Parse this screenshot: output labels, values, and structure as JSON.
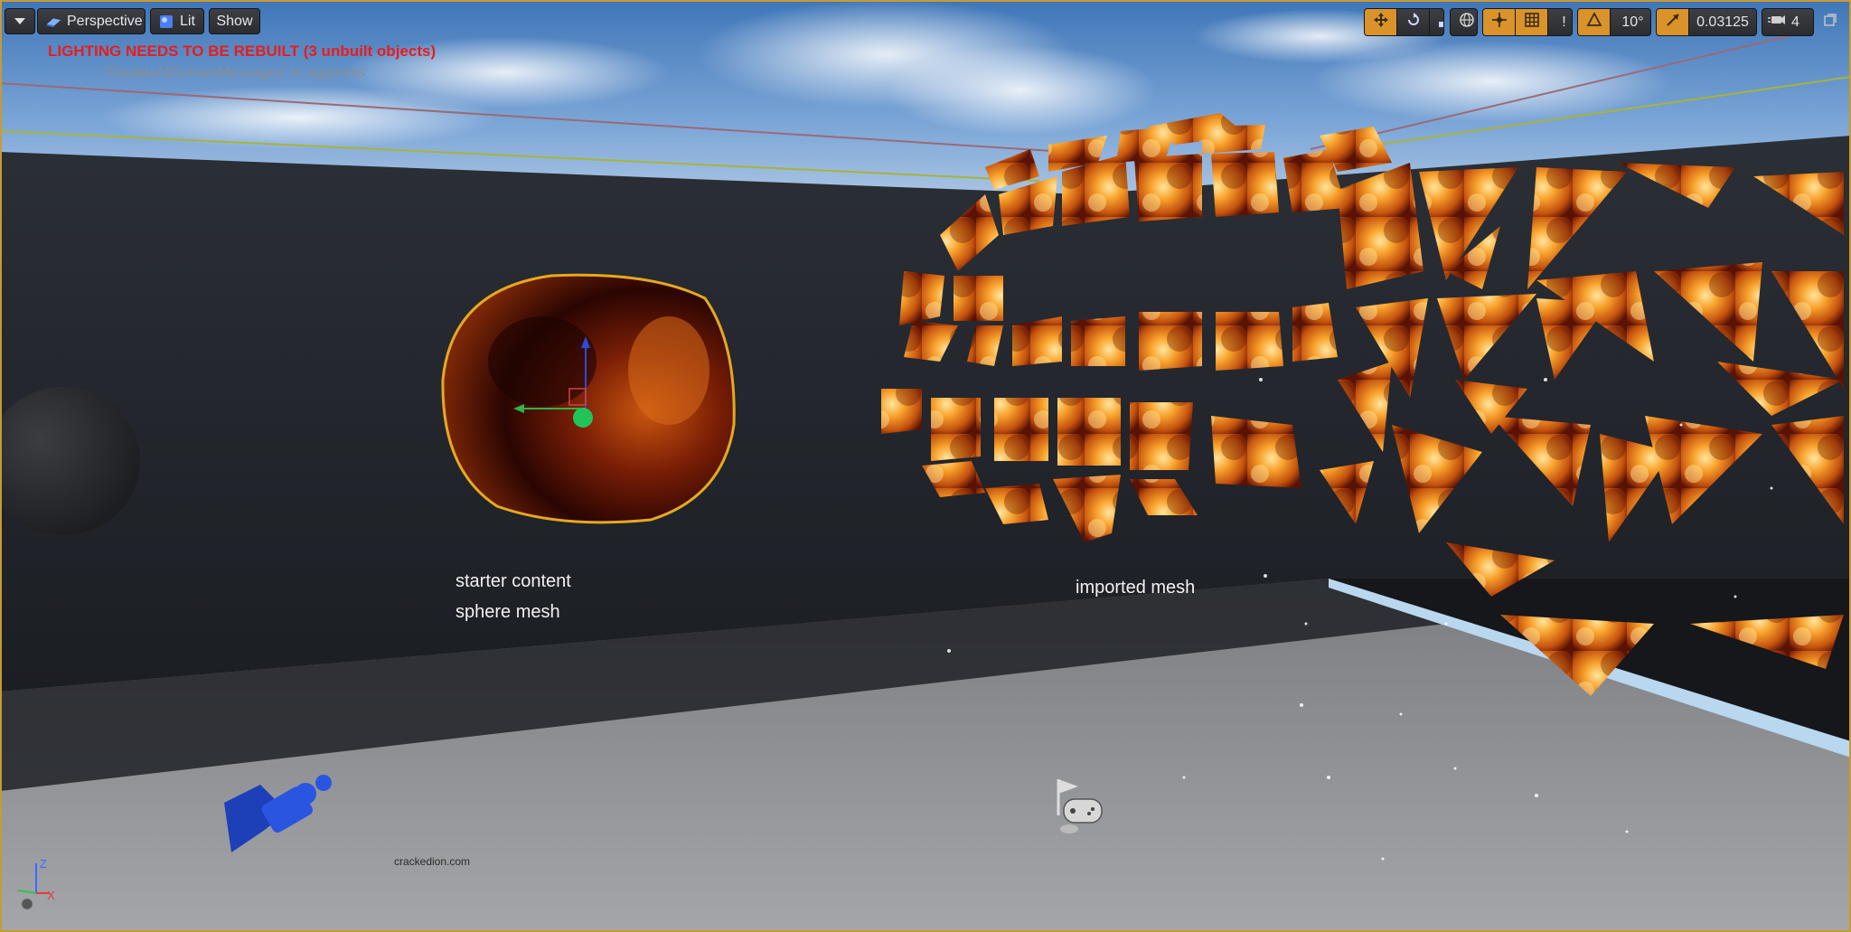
{
  "toolbar": {
    "menu_icon": "chevron-down-icon",
    "perspective": {
      "label": "Perspective",
      "icon": "perspective-cube-icon"
    },
    "lit": {
      "label": "Lit",
      "icon": "lit-sphere-icon"
    },
    "show": {
      "label": "Show"
    }
  },
  "right_toolbar": {
    "transform_tools": [
      {
        "icon": "translate-icon",
        "active": true
      },
      {
        "icon": "rotate-icon",
        "active": false
      },
      {
        "icon": "scale-icon",
        "active": false
      }
    ],
    "coordinate_space_icon": "world-globe-icon",
    "snap": {
      "surface_snap_icon": "surface-snap-icon",
      "grid_snap_icon": "grid-snap-icon",
      "grid_snap_value": "!",
      "rotation_snap_icon": "rotation-snap-icon",
      "rotation_snap_value": "10°",
      "scale_snap_icon": "scale-snap-icon",
      "scale_snap_value": "0.03125"
    },
    "camera_speed": {
      "icon": "camera-speed-icon",
      "value": "4"
    },
    "maximize_icon": "maximize-icon"
  },
  "messages": {
    "error": "LIGHTING NEEDS TO BE REBUILT (3 unbuilt objects)",
    "hint": "'DisableAllScreenMessages' to suppress"
  },
  "labels": {
    "sphere_line1": "starter content",
    "sphere_line2": "sphere mesh",
    "imported": "imported mesh"
  },
  "watermark": "crackedion.com",
  "axis": {
    "z": "Z",
    "x": "X"
  },
  "colors": {
    "accent": "#d9932a",
    "error": "#e81d1d",
    "selection_outline": "#e6a820",
    "fire_light": "#ffb43a",
    "fire_dark": "#3a0802"
  }
}
